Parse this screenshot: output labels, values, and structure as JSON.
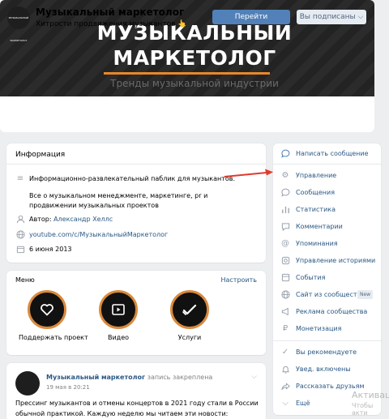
{
  "cover": {
    "title_line1": "МУЗЫКАЛЬНЫЙ",
    "title_line2": "МАРКЕТОЛОГ",
    "subtitle": "Тренды музыкальной индустрии",
    "accent_color": "#e8872b"
  },
  "header": {
    "avatar_text": "МУЗЫКАЛЬНЫЙ МАРКЕТОЛОГ",
    "name": "Музыкальный маркетолог",
    "status": "Хитрости продвижения музыкантов 👆",
    "go_button": "Перейти",
    "subscribed_button": "Вы подписаны ⌵"
  },
  "info": {
    "heading": "Информация",
    "description_1": "Информационно-развлекательный паблик для музыкантов.",
    "description_2": "Все о музыкальном менеджменте, маркетинге, pr и продвижении музыкальных проектов",
    "author_label": "Автор: ",
    "author_name": "Александр Хеллс",
    "youtube": "youtube.com/c/МузыкальныйМаркетолог",
    "date": "6 июня 2013"
  },
  "menu": {
    "heading": "Меню",
    "edit": "Настроить",
    "items": [
      {
        "label": "Поддержать проект",
        "icon": "heart-icon"
      },
      {
        "label": "Видео",
        "icon": "play-icon"
      },
      {
        "label": "Услуги",
        "icon": "check-icon"
      }
    ]
  },
  "post": {
    "author": "Музыкальный маркетолог",
    "pinned": " запись закреплена",
    "date": "19 мая в 20:21",
    "text": "Прессинг музыкантов и отмены концертов в 2021 году стали в России обычной практикой. Каждую неделю мы читаем эти новости: отменили концерт Нойзу МС,"
  },
  "sidebar": {
    "items": [
      {
        "label": "Написать сообщение",
        "icon": "message-icon"
      },
      {
        "label": "Управление",
        "icon": "gear-icon"
      },
      {
        "label": "Сообщения",
        "icon": "chat-icon"
      },
      {
        "label": "Статистика",
        "icon": "stats-icon"
      },
      {
        "label": "Комментарии",
        "icon": "comment-icon"
      },
      {
        "label": "Упоминания",
        "icon": "mention-icon"
      },
      {
        "label": "Управление историями",
        "icon": "stories-icon"
      },
      {
        "label": "События",
        "icon": "events-icon"
      },
      {
        "label": "Сайт из сообщества",
        "icon": "globe-icon",
        "badge": "New"
      },
      {
        "label": "Реклама сообщества",
        "icon": "megaphone-icon"
      },
      {
        "label": "Монетизация",
        "icon": "ruble-icon"
      },
      {
        "label": "Вы рекомендуете",
        "icon": "check-icon"
      },
      {
        "label": "Увед. включены",
        "icon": "bell-icon"
      },
      {
        "label": "Рассказать друзьям",
        "icon": "share-icon"
      },
      {
        "label": "Ещё",
        "icon": "chevron-down-icon"
      }
    ]
  },
  "watermark": {
    "line1": "Активаци",
    "line2": "Чтобы акти"
  }
}
